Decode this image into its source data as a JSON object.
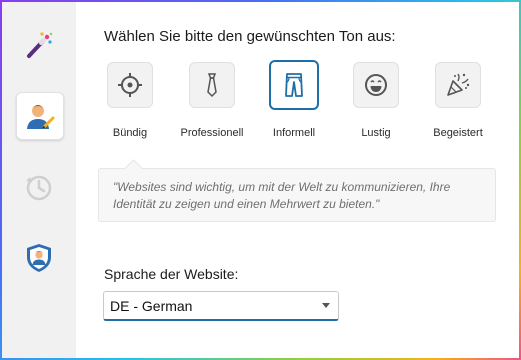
{
  "sidebar": {
    "items": [
      {
        "icon": "magic-wand-icon"
      },
      {
        "icon": "user-edit-icon",
        "active": true
      },
      {
        "icon": "history-clock-icon"
      },
      {
        "icon": "shield-user-icon"
      }
    ]
  },
  "main": {
    "heading": "Wählen Sie bitte den gewünschten Ton aus:",
    "tones": [
      {
        "label": "Bündig",
        "icon": "target-icon"
      },
      {
        "label": "Professionell",
        "icon": "tie-icon"
      },
      {
        "label": "Informell",
        "icon": "jeans-icon",
        "selected": true
      },
      {
        "label": "Lustig",
        "icon": "laughing-face-icon"
      },
      {
        "label": "Begeistert",
        "icon": "party-popper-icon"
      }
    ],
    "example_quote": "\"Websites sind wichtig, um mit der Welt zu kommunizieren, Ihre Identität zu zeigen und  einen Mehrwert zu bieten.\"",
    "language_label": "Sprache der Website:",
    "language_value": "DE - German"
  },
  "colors": {
    "accent": "#1e6fa8",
    "sidebar_bg": "#f1f1f1"
  }
}
